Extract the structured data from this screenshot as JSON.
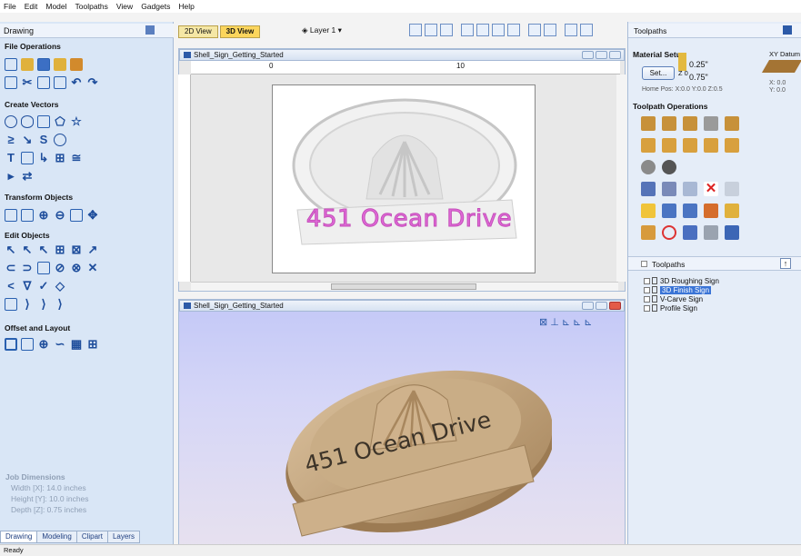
{
  "menu": [
    "File",
    "Edit",
    "Model",
    "Toolpaths",
    "View",
    "Gadgets",
    "Help"
  ],
  "left_panel": {
    "title": "Drawing",
    "sections": [
      {
        "title": "File Operations"
      },
      {
        "title": "Create Vectors"
      },
      {
        "title": "Transform Objects"
      },
      {
        "title": "Edit Objects"
      },
      {
        "title": "Offset and Layout"
      }
    ],
    "job_dimensions": {
      "title": "Job Dimensions",
      "width": "Width  [X]: 14.0 inches",
      "height": "Height [Y]: 10.0 inches",
      "depth": "Depth  [Z]: 0.75 inches"
    },
    "bottom_tabs": [
      "Drawing",
      "Modeling",
      "Clipart",
      "Layers"
    ]
  },
  "view_tabs": [
    "2D View",
    "3D View"
  ],
  "layer_label": "Layer 1",
  "viewport_2d": {
    "title": "Shell_Sign_Getting_Started",
    "ruler_marks": [
      "0",
      "10"
    ],
    "sign_text": "451 Ocean Drive"
  },
  "viewport_3d": {
    "title": "Shell_Sign_Getting_Started",
    "sign_text": "451 Ocean Drive"
  },
  "right_panel": {
    "title": "Toolpaths",
    "material_setup": "Material Setup",
    "xy_datum": "XY Datum",
    "set_button": "Set...",
    "z_label": "Z 0",
    "dim_top": "0.25\"",
    "dim_bottom": "0.75\"",
    "home_pos": "Home Pos:  X:0.0 Y:0.0 Z:0.5",
    "xy_vals": "X: 0.0\nY: 0.0",
    "toolpath_operations": "Toolpath Operations",
    "list_title": "Toolpaths",
    "toolpaths": [
      {
        "name": "3D Roughing Sign",
        "selected": false
      },
      {
        "name": "3D Finish Sign",
        "selected": true
      },
      {
        "name": "V-Carve Sign",
        "selected": false
      },
      {
        "name": "Profile Sign",
        "selected": false
      }
    ]
  },
  "status": "Ready",
  "colors": {
    "accent": "#3a74d6",
    "wood": "#c7a77f",
    "sign_text_2d": "#e06ad8",
    "panel_bg": "#d9e6f6"
  }
}
